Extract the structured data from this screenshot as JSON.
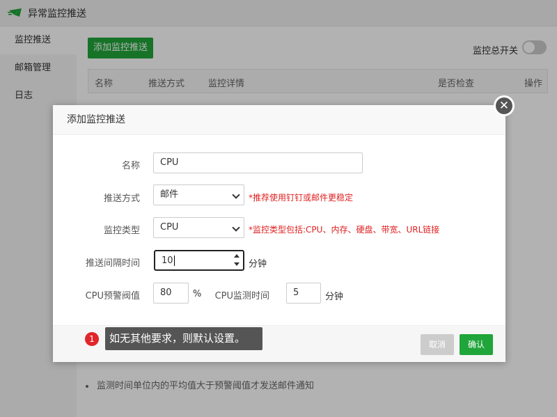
{
  "window": {
    "title": "异常监控推送"
  },
  "sidebar": {
    "items": [
      {
        "label": "监控推送",
        "active": true
      },
      {
        "label": "邮箱管理",
        "active": false
      },
      {
        "label": "日志",
        "active": false
      }
    ]
  },
  "main": {
    "add_button": "添加监控推送",
    "master_switch_label": "监控总开关",
    "master_switch_on": false,
    "table_headers": [
      "名称",
      "推送方式",
      "监控详情",
      "是否检查",
      "操作"
    ],
    "note": "监测时间单位内的平均值大于预警阈值才发送邮件通知"
  },
  "dialog": {
    "title": "添加监控推送",
    "fields": {
      "name": {
        "label": "名称",
        "value": "CPU"
      },
      "push_method": {
        "label": "推送方式",
        "value": "邮件",
        "hint": "*推荐使用钉钉或邮件更稳定"
      },
      "monitor_type": {
        "label": "监控类型",
        "value": "CPU",
        "hint": "*监控类型包括:CPU、内存、硬盘、带宽、URL链接"
      },
      "interval": {
        "label": "推送间隔时间",
        "value": "10",
        "unit": "分钟"
      },
      "cpu_threshold": {
        "label": "CPU预警阀值",
        "value": "80",
        "unit": "%"
      },
      "cpu_monitor_time": {
        "label": "CPU监测时间",
        "value": "5",
        "unit": "分钟"
      }
    },
    "cancel_button": "取消",
    "confirm_button": "确认"
  },
  "annotation": {
    "step": "1",
    "text": "如无其他要求，则默认设置。"
  },
  "colors": {
    "accent": "#20a53a",
    "hint": "#e02020",
    "badge": "#e0262b",
    "tooltip_bg": "#555555"
  }
}
